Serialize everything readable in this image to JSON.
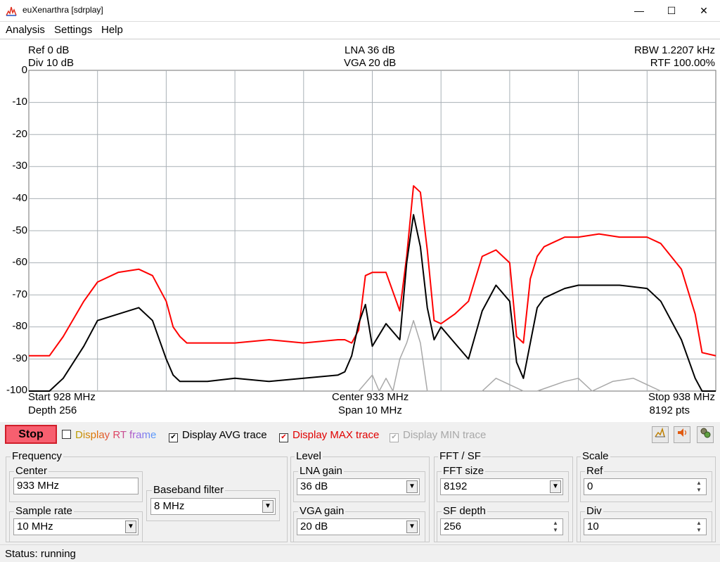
{
  "window": {
    "title": "euXenarthra [sdrplay]",
    "minimize": "—",
    "maximize": "☐",
    "close": "✕"
  },
  "menu": {
    "items": [
      "Analysis",
      "Settings",
      "Help"
    ]
  },
  "plot": {
    "ref_label": "Ref 0 dB",
    "div_label": "Div 10 dB",
    "lna_label": "LNA 36 dB",
    "vga_label": "VGA 20 dB",
    "rbw_label": "RBW 1.2207 kHz",
    "rtf_label": "RTF 100.00%",
    "start_label": "Start 928 MHz",
    "depth_label": "Depth 256",
    "center_label": "Center 933 MHz",
    "span_label": "Span 10 MHz",
    "stop_label": "Stop 938 MHz",
    "pts_label": "8192 pts",
    "y_ticks": [
      "0",
      "-10",
      "-20",
      "-30",
      "-40",
      "-50",
      "-60",
      "-70",
      "-80",
      "-90",
      "-100"
    ]
  },
  "chart_data": {
    "type": "line",
    "xlim": [
      928,
      938
    ],
    "ylim": [
      -100,
      0
    ],
    "grid": true,
    "series": [
      {
        "color": "#ff0000",
        "x": [
          928.0,
          928.3,
          928.5,
          928.8,
          929.0,
          929.3,
          929.6,
          929.8,
          930.0,
          930.1,
          930.2,
          930.3,
          930.6,
          931.0,
          931.5,
          932.0,
          932.5,
          932.6,
          932.7,
          932.8,
          932.9,
          933.0,
          933.2,
          933.4,
          933.5,
          933.6,
          933.7,
          933.8,
          933.9,
          934.0,
          934.2,
          934.4,
          934.6,
          934.8,
          935.0,
          935.1,
          935.2,
          935.3,
          935.4,
          935.5,
          935.6,
          935.7,
          935.8,
          936.0,
          936.3,
          936.6,
          937.0,
          937.2,
          937.5,
          937.7,
          937.8,
          938.0
        ],
        "values": [
          -89,
          -89,
          -83,
          -72,
          -66,
          -63,
          -62,
          -64,
          -72,
          -80,
          -83,
          -85,
          -85,
          -85,
          -84,
          -85,
          -84,
          -84,
          -85,
          -81,
          -64,
          -63,
          -63,
          -75,
          -58,
          -36,
          -38,
          -56,
          -78,
          -79,
          -76,
          -72,
          -58,
          -56,
          -60,
          -83,
          -85,
          -65,
          -58,
          -55,
          -54,
          -53,
          -52,
          -52,
          -51,
          -52,
          -52,
          -54,
          -62,
          -76,
          -88,
          -89
        ]
      },
      {
        "color": "#000000",
        "x": [
          928.0,
          928.3,
          928.5,
          928.8,
          929.0,
          929.3,
          929.6,
          929.8,
          930.0,
          930.1,
          930.2,
          930.3,
          930.6,
          931.0,
          931.5,
          932.0,
          932.5,
          932.6,
          932.7,
          932.8,
          932.9,
          933.0,
          933.2,
          933.4,
          933.5,
          933.6,
          933.7,
          933.8,
          933.9,
          934.0,
          934.2,
          934.4,
          934.6,
          934.8,
          935.0,
          935.1,
          935.2,
          935.3,
          935.4,
          935.5,
          935.6,
          935.7,
          935.8,
          936.0,
          936.3,
          936.6,
          937.0,
          937.2,
          937.5,
          937.7,
          937.8,
          938.0
        ],
        "values": [
          -100,
          -100,
          -96,
          -86,
          -78,
          -76,
          -74,
          -78,
          -90,
          -95,
          -97,
          -97,
          -97,
          -96,
          -97,
          -96,
          -95,
          -94,
          -89,
          -79,
          -73,
          -86,
          -79,
          -84,
          -60,
          -45,
          -55,
          -74,
          -84,
          -80,
          -85,
          -90,
          -75,
          -67,
          -72,
          -91,
          -96,
          -85,
          -74,
          -71,
          -70,
          -69,
          -68,
          -67,
          -67,
          -67,
          -68,
          -72,
          -84,
          -96,
          -100,
          -100
        ]
      },
      {
        "color": "#a8a8a8",
        "x": [
          932.8,
          933.0,
          933.1,
          933.2,
          933.3,
          933.4,
          933.5,
          933.6,
          933.7,
          933.8,
          934.0,
          934.6,
          934.8,
          935.0,
          935.2,
          935.4,
          935.8,
          936.0,
          936.2,
          936.5,
          936.8,
          937.0,
          937.2
        ],
        "values": [
          -100,
          -95,
          -100,
          -96,
          -100,
          -90,
          -85,
          -78,
          -85,
          -100,
          -100,
          -100,
          -96,
          -98,
          -100,
          -100,
          -97,
          -96,
          -100,
          -97,
          -96,
          -98,
          -100
        ]
      }
    ]
  },
  "controls": {
    "stop_label": "Stop",
    "rt_frame_label": "Display RT frame",
    "avg_label": "Display AVG trace",
    "max_label": "Display MAX trace",
    "min_label": "Display MIN trace"
  },
  "frequency": {
    "title": "Frequency",
    "center_label": "Center",
    "center_value": "933 MHz",
    "sample_rate_label": "Sample rate",
    "sample_rate_value": "10 MHz",
    "baseband_label": "Baseband filter",
    "baseband_value": "8 MHz"
  },
  "level": {
    "title": "Level",
    "lna_label": "LNA gain",
    "lna_value": "36 dB",
    "vga_label": "VGA gain",
    "vga_value": "20 dB"
  },
  "fft": {
    "title": "FFT / SF",
    "size_label": "FFT size",
    "size_value": "8192",
    "depth_label": "SF depth",
    "depth_value": "256"
  },
  "scale": {
    "title": "Scale",
    "ref_label": "Ref",
    "ref_value": "0",
    "div_label": "Div",
    "div_value": "10"
  },
  "status": {
    "text": "Status: running"
  }
}
